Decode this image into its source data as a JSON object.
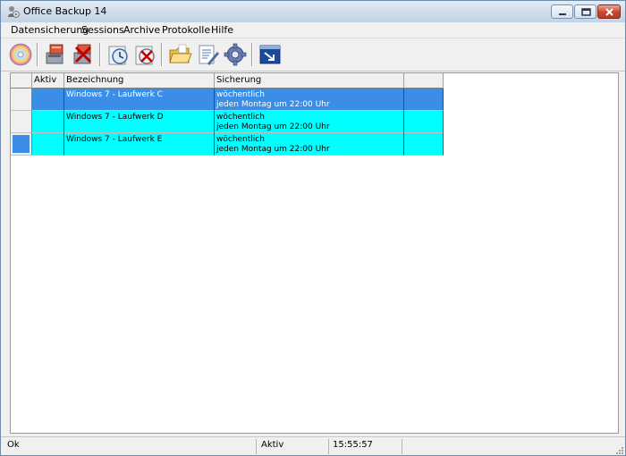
{
  "window": {
    "title": "Office Backup 14",
    "app_icon": "person-disc-icon"
  },
  "window_controls": {
    "minimize": "minimize-icon",
    "maximize": "maximize-icon",
    "close": "close-icon"
  },
  "menu": {
    "items": [
      "Datensicherung",
      "Sessions",
      "Archive",
      "Protokolle",
      "Hilfe"
    ]
  },
  "toolbar": {
    "buttons": [
      {
        "icon": "disc-icon"
      },
      {
        "icon": "backup-drive-icon"
      },
      {
        "icon": "delete-drive-icon"
      },
      {
        "icon": "schedule-clock-icon"
      },
      {
        "icon": "cancel-schedule-icon"
      },
      {
        "icon": "open-folder-icon"
      },
      {
        "icon": "edit-document-icon"
      },
      {
        "icon": "settings-gear-icon"
      },
      {
        "icon": "window-arrow-icon"
      }
    ]
  },
  "grid": {
    "columns": [
      "Aktiv",
      "Bezeichnung",
      "Sicherung",
      ""
    ],
    "rows": [
      {
        "aktiv": "",
        "bezeichnung": "Windows 7 - Laufwerk C",
        "sicherung_1": "wöchentlich",
        "sicherung_2": "jeden Montag um 22:00 Uhr",
        "selected": true,
        "current": false
      },
      {
        "aktiv": "",
        "bezeichnung": "Windows 7 - Laufwerk D",
        "sicherung_1": "wöchentlich",
        "sicherung_2": "jeden Montag um 22:00 Uhr",
        "selected": false,
        "current": false
      },
      {
        "aktiv": "",
        "bezeichnung": "Windows 7 - Laufwerk E",
        "sicherung_1": "wöchentlich",
        "sicherung_2": "jeden Montag um 22:00 Uhr",
        "selected": false,
        "current": true
      }
    ],
    "colors": {
      "selected_row": "#3a8ee6",
      "row": "#00ffff"
    }
  },
  "status": {
    "message": "Ok",
    "state": "Aktiv",
    "time": "15:55:57"
  }
}
